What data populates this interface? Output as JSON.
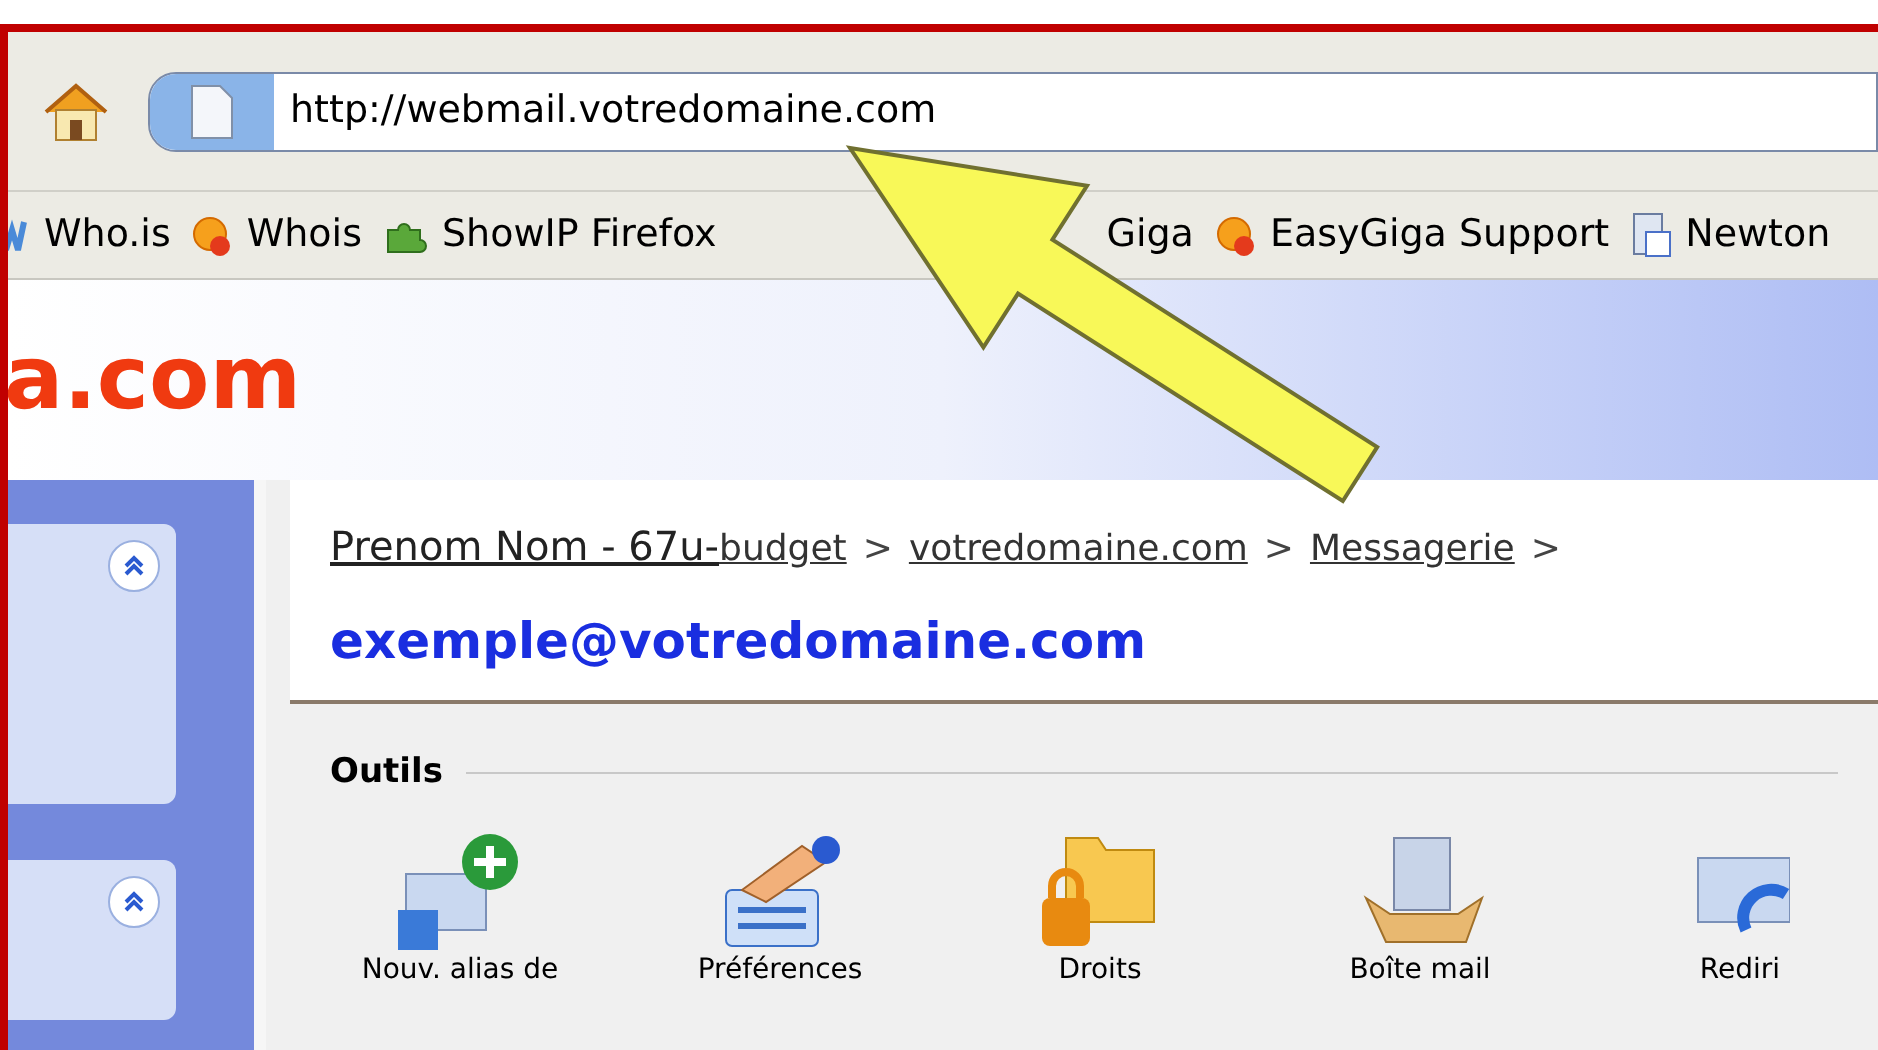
{
  "address_bar": {
    "url": "http://webmail.votredomaine.com"
  },
  "bookmarks": [
    {
      "label": "Who.is",
      "kind": "w"
    },
    {
      "label": "Whois",
      "kind": "e"
    },
    {
      "label": "ShowIP Firefox",
      "kind": "puzzle"
    },
    {
      "label": "Giga",
      "kind": "plain"
    },
    {
      "label": "EasyGiga Support",
      "kind": "e"
    },
    {
      "label": "Newton",
      "kind": "doc"
    }
  ],
  "header": {
    "logo": "a.com"
  },
  "breadcrumb": [
    {
      "label": "Prenom Nom - 67u-",
      "kind": "plain"
    },
    {
      "label": "budget",
      "kind": "link"
    },
    {
      "label": ">",
      "kind": "sep"
    },
    {
      "label": "votredomaine.com",
      "kind": "link"
    },
    {
      "label": ">",
      "kind": "sep"
    },
    {
      "label": "Messagerie",
      "kind": "link"
    },
    {
      "label": ">",
      "kind": "sep"
    }
  ],
  "account": "exemple@votredomaine.com",
  "section": {
    "title": "Outils"
  },
  "tools": [
    {
      "label": "Nouv. alias de",
      "kind": "alias"
    },
    {
      "label": "Préférences",
      "kind": "prefs"
    },
    {
      "label": "Droits",
      "kind": "rights"
    },
    {
      "label": "Boîte mail",
      "kind": "mailbox"
    },
    {
      "label": "Rediri",
      "kind": "redirect"
    }
  ]
}
